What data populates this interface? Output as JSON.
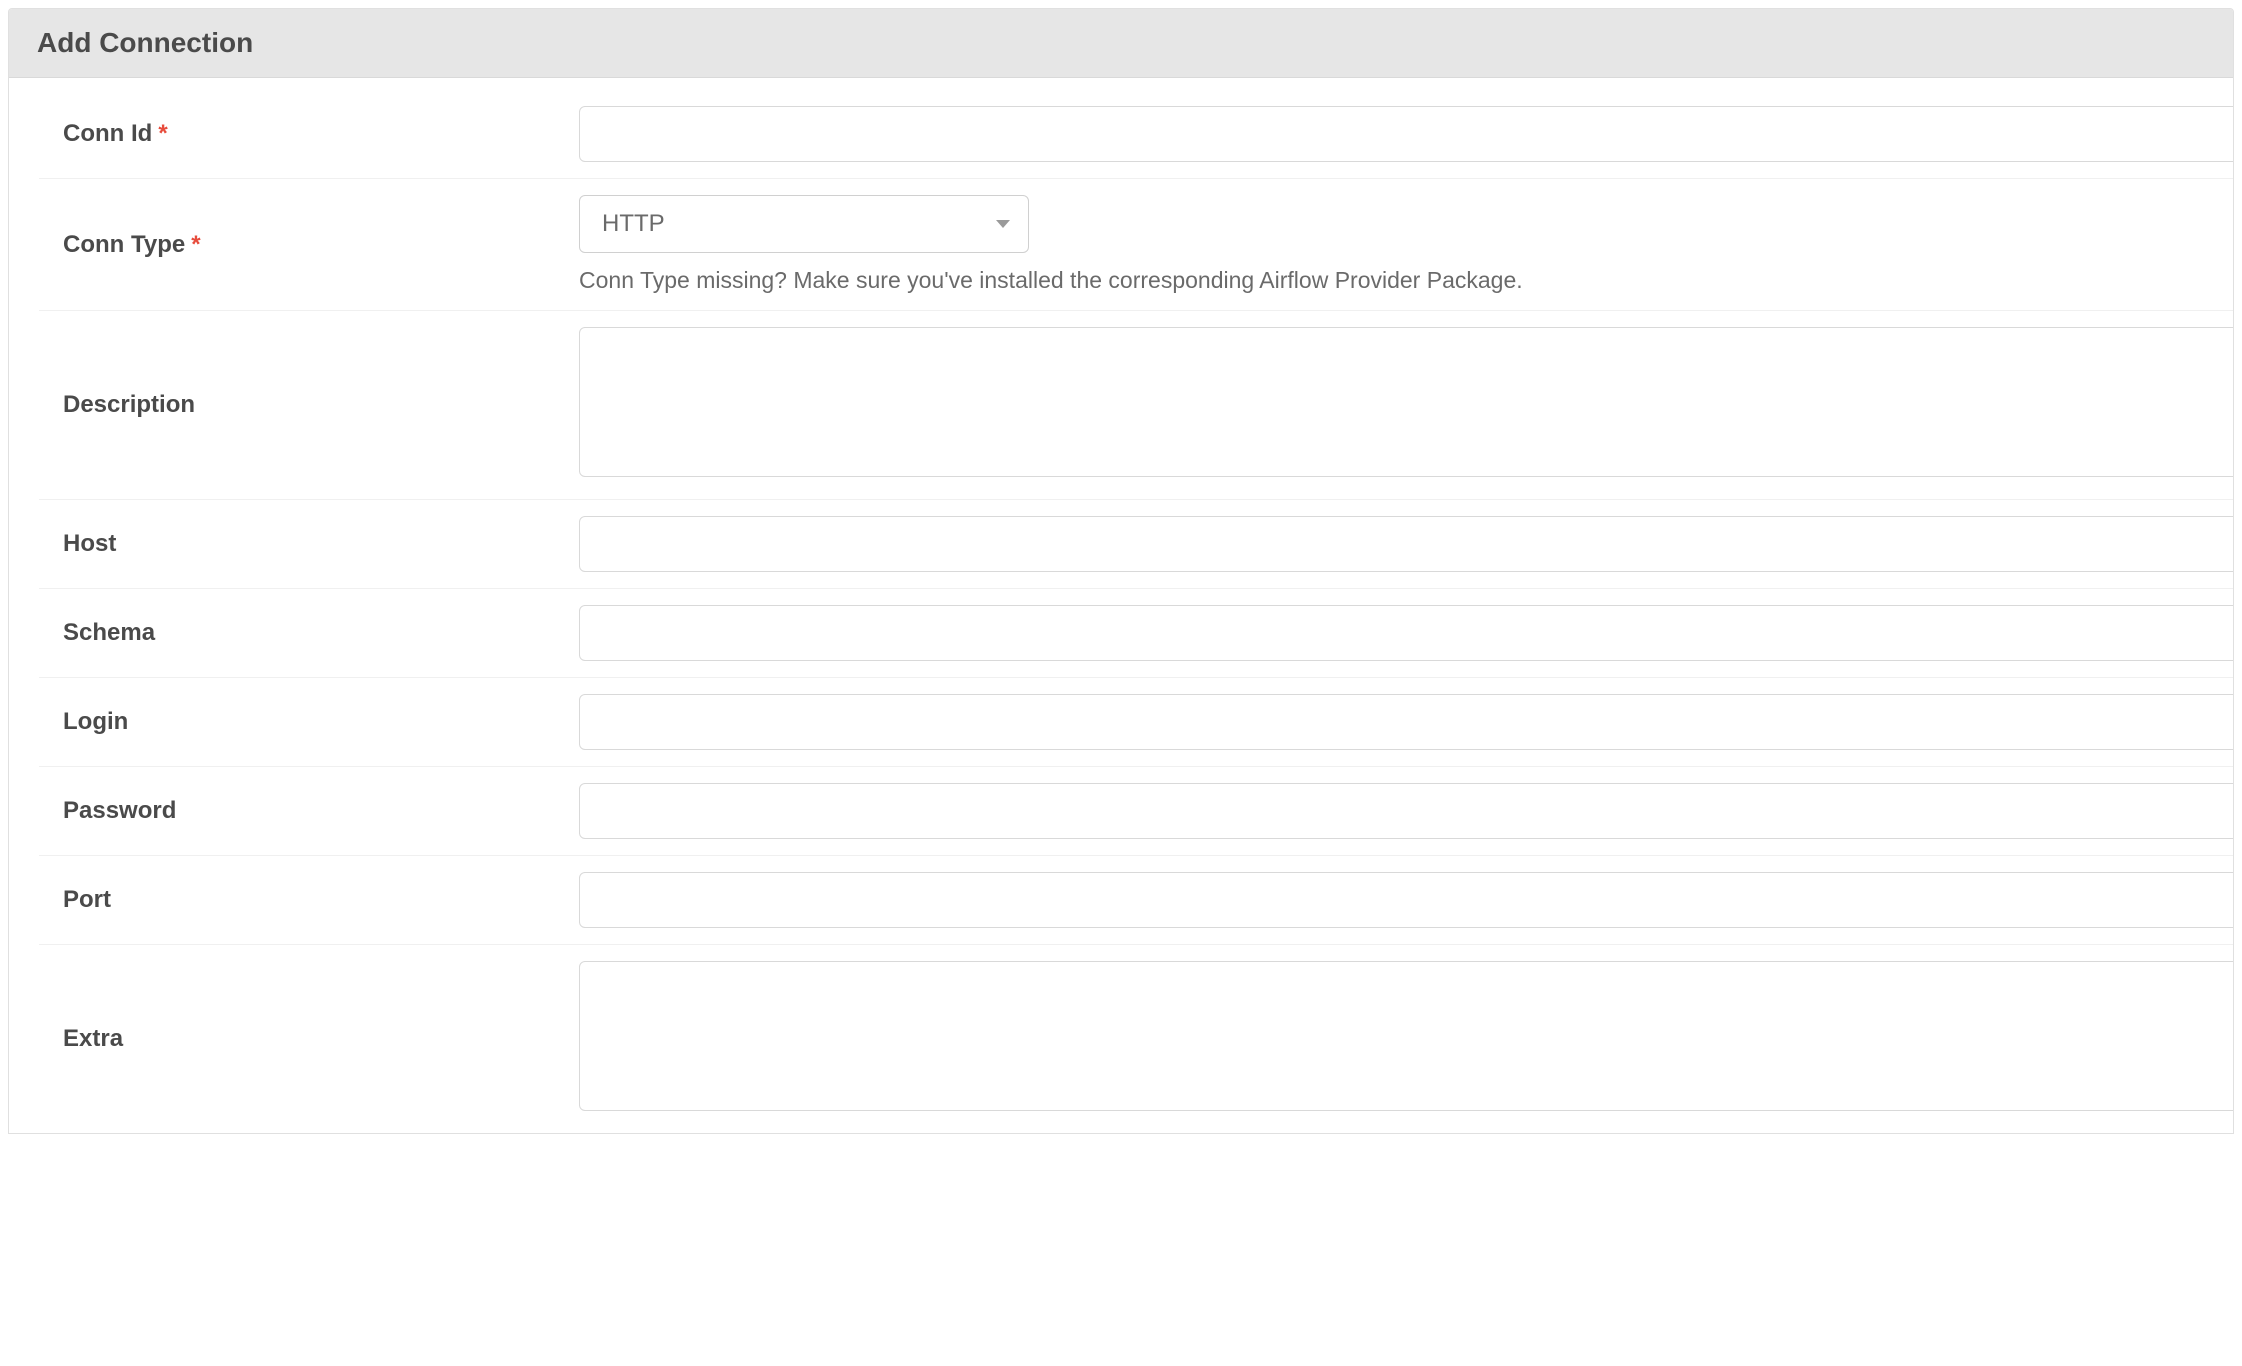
{
  "header": {
    "title": "Add Connection"
  },
  "form": {
    "conn_id": {
      "label": "Conn Id",
      "required": true,
      "value": ""
    },
    "conn_type": {
      "label": "Conn Type",
      "required": true,
      "selected": "HTTP",
      "helper": "Conn Type missing? Make sure you've installed the corresponding Airflow Provider Package."
    },
    "description": {
      "label": "Description",
      "value": ""
    },
    "host": {
      "label": "Host",
      "value": ""
    },
    "schema": {
      "label": "Schema",
      "value": ""
    },
    "login": {
      "label": "Login",
      "value": ""
    },
    "password": {
      "label": "Password",
      "value": ""
    },
    "port": {
      "label": "Port",
      "value": ""
    },
    "extra": {
      "label": "Extra",
      "value": ""
    }
  },
  "required_marker": "*"
}
